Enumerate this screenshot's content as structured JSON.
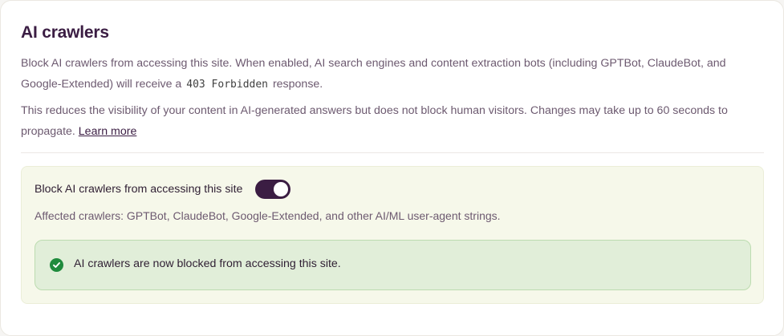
{
  "section": {
    "title": "AI crawlers",
    "description_1_before": "Block AI crawlers from accessing this site. When enabled, AI search engines and content extraction bots (including GPTBot, ClaudeBot, and Google-Extended) will receive a ",
    "description_1_code": "403 Forbidden",
    "description_1_after": " response.",
    "description_2": "This reduces the visibility of your content in AI-generated answers but does not block human visitors. Changes may take up to 60 seconds to propagate. ",
    "learn_more": "Learn more"
  },
  "setting": {
    "toggle_label": "Block AI crawlers from accessing this site",
    "toggle_on": true,
    "affected": "Affected crawlers: GPTBot, ClaudeBot, Google-Extended, and other AI/ML user-agent strings."
  },
  "alert": {
    "icon": "check-circle-icon",
    "message": "AI crawlers are now blocked from accessing this site."
  },
  "colors": {
    "title": "#3b1d43",
    "toggle_on": "#3b1d43",
    "success": "#1f8b3d",
    "alert_bg": "#e1eed9",
    "panel_bg": "#f6f8ea"
  }
}
